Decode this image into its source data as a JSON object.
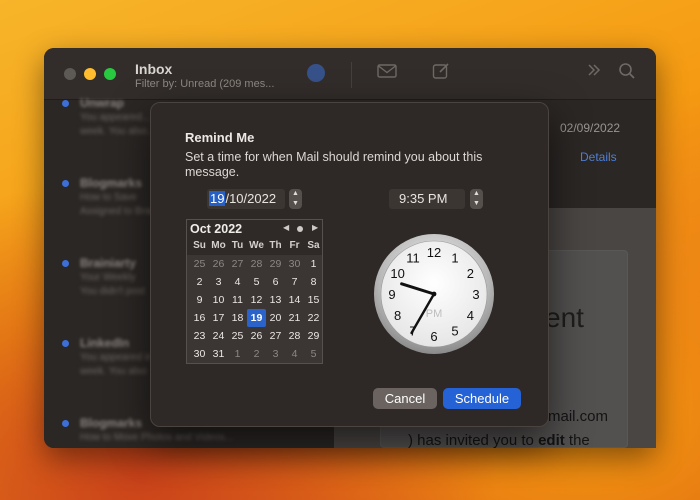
{
  "mail": {
    "title": "Inbox",
    "subtitle": "Filter by: Unread (209 mes...",
    "list_items": [
      {
        "sender": "Unwrap",
        "line1": "You appeared...",
        "line2": "week. You also..."
      },
      {
        "sender": "Blogmarks",
        "line1": "How to Save",
        "line2": "Assigned to Brad"
      },
      {
        "sender": "Brainiarty",
        "line1": "Your Weekly",
        "line2": "You didn't post"
      },
      {
        "sender": "LinkedIn",
        "line1": "You appeared in",
        "line2": "week. You also"
      },
      {
        "sender": "Blogmarks",
        "line1": "How to Move Photos and Videos..."
      }
    ],
    "detail": {
      "date": "02/09/2022",
      "details_link": "Details",
      "big_text": "ent",
      "email_fragment": "mail.com",
      "invite_pre": ") has invited you to ",
      "invite_bold": "edit",
      "invite_post": " the"
    }
  },
  "dialog": {
    "title": "Remind Me",
    "message": "Set a time for when Mail should remind you about this message.",
    "date_day": "19",
    "date_rest": "/10/2022",
    "time": "9:35 PM",
    "calendar": {
      "month": "Oct 2022",
      "weekdays": [
        "Su",
        "Mo",
        "Tu",
        "We",
        "Th",
        "Fr",
        "Sa"
      ],
      "weeks": [
        [
          "25",
          "26",
          "27",
          "28",
          "29",
          "30",
          "1"
        ],
        [
          "2",
          "3",
          "4",
          "5",
          "6",
          "7",
          "8"
        ],
        [
          "9",
          "10",
          "11",
          "12",
          "13",
          "14",
          "15"
        ],
        [
          "16",
          "17",
          "18",
          "19",
          "20",
          "21",
          "22"
        ],
        [
          "23",
          "24",
          "25",
          "26",
          "27",
          "28",
          "29"
        ],
        [
          "30",
          "31",
          "1",
          "2",
          "3",
          "4",
          "5"
        ]
      ],
      "selected_day": "19"
    },
    "clock": {
      "numbers": [
        "12",
        "1",
        "2",
        "3",
        "4",
        "5",
        "6",
        "7",
        "8",
        "9",
        "10",
        "11"
      ],
      "hour": 9,
      "minute": 35,
      "period": "PM"
    },
    "cancel_label": "Cancel",
    "schedule_label": "Schedule"
  },
  "colors": {
    "accent": "#2562d6",
    "dialog_bg": "#2e2826",
    "unread_dot": "#3d6fd9"
  }
}
